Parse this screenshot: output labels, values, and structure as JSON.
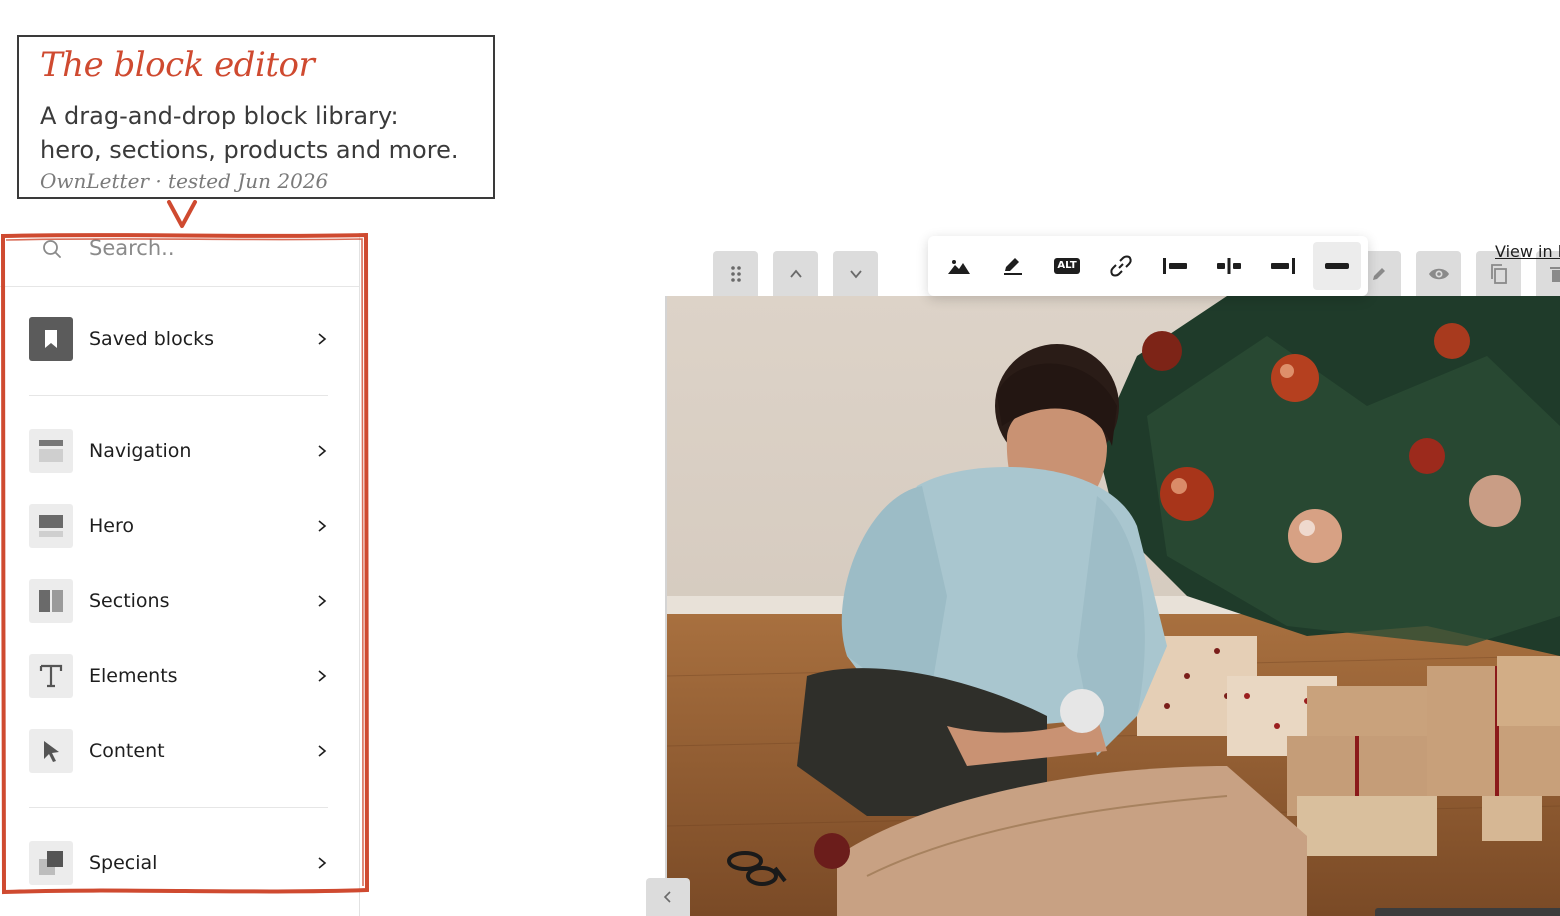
{
  "callout": {
    "title": "The block editor",
    "description_line1": "A drag-and-drop block library:",
    "description_line2": "hero, sections, products and more.",
    "meta": "OwnLetter · tested Jun 2026"
  },
  "sidebar": {
    "search": {
      "placeholder": "Search.."
    },
    "items": [
      {
        "label": "Saved blocks",
        "icon": "bookmark-icon"
      },
      {
        "label": "Navigation",
        "icon": "navigation-block-icon"
      },
      {
        "label": "Hero",
        "icon": "hero-block-icon"
      },
      {
        "label": "Sections",
        "icon": "sections-block-icon"
      },
      {
        "label": "Elements",
        "icon": "text-element-icon"
      },
      {
        "label": "Content",
        "icon": "cursor-pointer-icon"
      },
      {
        "label": "Special",
        "icon": "special-blocks-icon"
      }
    ]
  },
  "canvas": {
    "view_link": "View in b",
    "block_controls": [
      "drag-handle-icon",
      "move-up-icon",
      "move-down-icon",
      "edit-pencil-icon",
      "visibility-eye-icon",
      "duplicate-icon",
      "delete-trash-icon"
    ],
    "image_toolbar": {
      "buttons": [
        "replace-image-icon",
        "edit-image-icon",
        "alt-text-icon",
        "link-icon",
        "align-left-icon",
        "align-center-icon",
        "align-right-icon",
        "full-width-icon"
      ],
      "alt_badge": "ALT",
      "active": "full-width-icon"
    },
    "image_alt": "Woman wrapping gifts beside a Christmas tree"
  },
  "colors": {
    "accent_red": "#cf4a30",
    "icon_dark": "#1e1e1e",
    "control_bg": "#dcdcdc"
  }
}
